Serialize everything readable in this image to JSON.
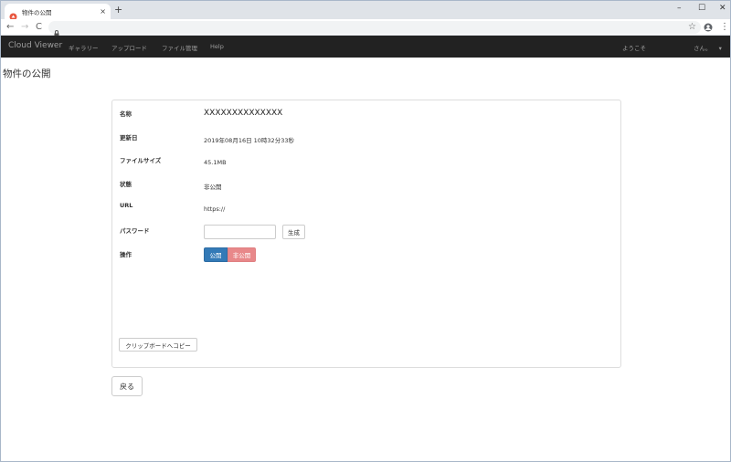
{
  "browser": {
    "tab_title": "物件の公開",
    "tab_close": "×",
    "new_tab": "+",
    "win_minimize": "–",
    "win_maximize": "☐",
    "win_close": "✕",
    "back": "←",
    "forward": "→",
    "reload": "C",
    "star": "☆",
    "menu": "⋮"
  },
  "navbar": {
    "brand": "Cloud Viewer",
    "items": [
      "ギャラリー",
      "アップロード",
      "ファイル管理",
      "Help"
    ],
    "welcome": "ようこそ",
    "user": "さん。",
    "caret": "▾"
  },
  "page": {
    "title": "物件の公開"
  },
  "details": {
    "name_label": "名称",
    "name_value": "XXXXXXXXXXXXXX",
    "updated_label": "更新日",
    "updated_value": "2019年08月16日 10時32分33秒",
    "size_label": "ファイルサイズ",
    "size_value": "45.1MB",
    "status_label": "状態",
    "status_value": "非公開",
    "url_label": "URL",
    "url_value": "https://",
    "password_label": "パスワード",
    "generate_button": "生成",
    "operation_label": "操作",
    "publish_button": "公開",
    "unpublish_button": "非公開",
    "copy_button": "クリップボードへコピー"
  },
  "footer": {
    "back_button": "戻る"
  },
  "colors": {
    "navbar": "#222222",
    "primary": "#337ab7",
    "danger_light": "#e8888a"
  }
}
